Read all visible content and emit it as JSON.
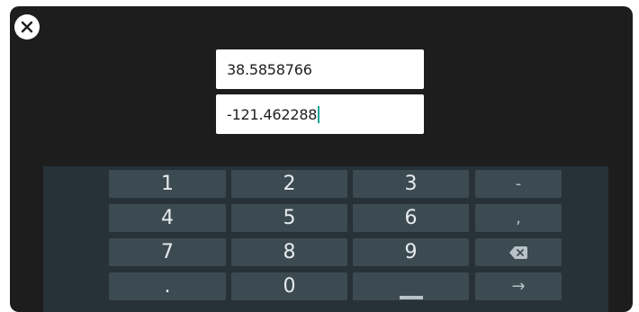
{
  "fields": {
    "latitude": "38.5858766",
    "longitude": "-121.462288"
  },
  "keyboard": {
    "rows": [
      [
        "1",
        "2",
        "3",
        "-"
      ],
      [
        "4",
        "5",
        "6",
        ","
      ],
      [
        "7",
        "8",
        "9",
        ""
      ],
      [
        ".",
        "0",
        "",
        "→"
      ]
    ]
  },
  "colors": {
    "window_bg": "#1d1d1d",
    "keyboard_bg": "#263238",
    "key_bg": "#3c4a51",
    "caret": "#1aa39a"
  },
  "icons": {
    "close": "close-icon",
    "backspace": "backspace-icon",
    "space": "space-icon",
    "next": "arrow-right-icon"
  }
}
